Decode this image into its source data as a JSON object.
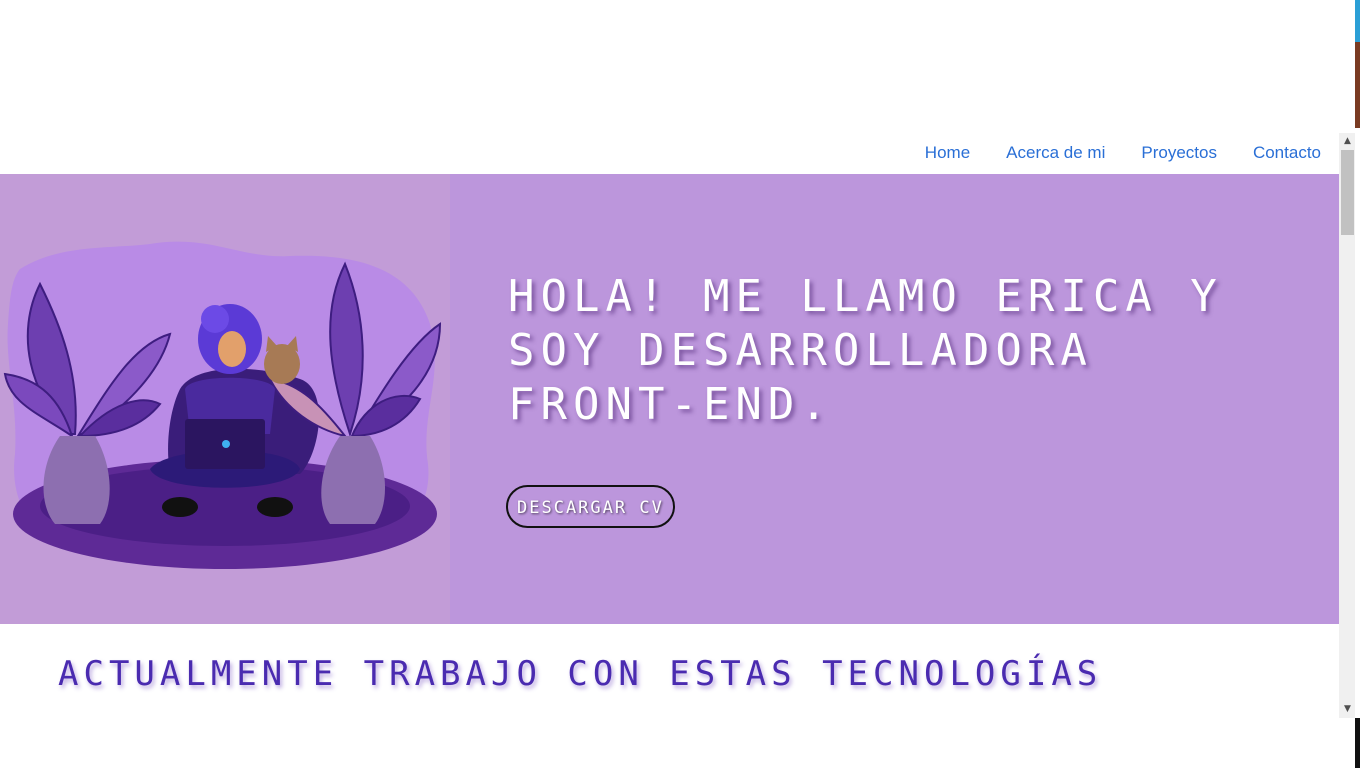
{
  "nav": {
    "items": [
      {
        "label": "Home"
      },
      {
        "label": "Acerca de mi"
      },
      {
        "label": "Proyectos"
      },
      {
        "label": "Contacto"
      }
    ]
  },
  "hero": {
    "title": "Hola! Me llamo Erica y soy desarrolladora Front-End.",
    "cv_button": "Descargar CV",
    "illustration": "woman-with-laptop-illustration"
  },
  "tech": {
    "title": "Actualmente trabajo con estas tecnologías"
  },
  "scrollbar": {
    "up_icon": "triangle-up-icon",
    "down_icon": "triangle-down-icon"
  },
  "colors": {
    "hero_background": "#bc96dc",
    "illustration_background": "#c29cd7",
    "nav_link": "#2a6fd6",
    "tech_title": "#4a2bb0"
  }
}
